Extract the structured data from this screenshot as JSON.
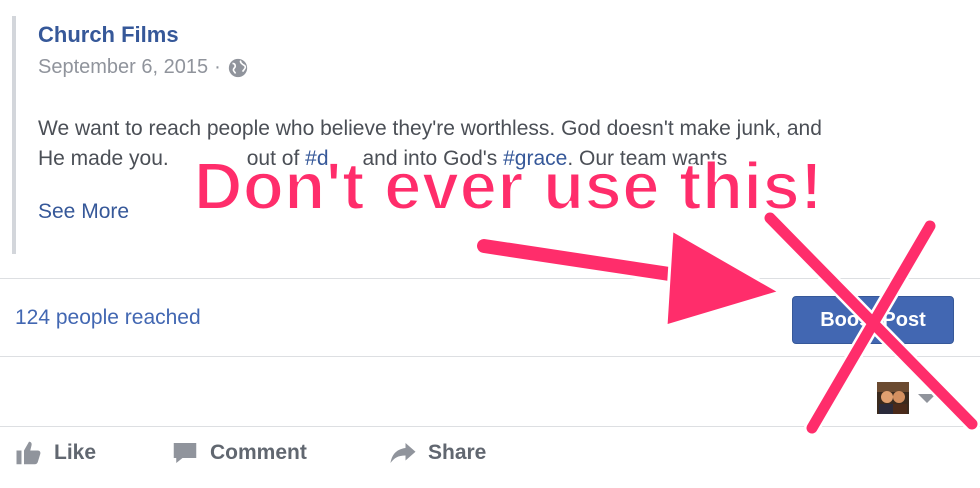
{
  "post": {
    "page_name": "Church Films",
    "date": "September 6, 2015",
    "separator": "·",
    "audience_icon": "globe-icon",
    "text_line1": "We want to reach people who believe they're worthless. God doesn't make junk, and",
    "text_line2_a": "He made you.",
    "text_line2_b": "out of",
    "hashtag1": "#d",
    "text_line2_c": "and into God's",
    "hashtag2": "#grace",
    "text_line2_d": ". Our team wants",
    "see_more": "See More"
  },
  "insights": {
    "reach_text": "124 people reached",
    "boost_label": "Boost Post"
  },
  "actions": {
    "like": "Like",
    "comment": "Comment",
    "share": "Share"
  },
  "annotation": {
    "callout": "Don't ever use this!",
    "accent_color": "#ff2d6b"
  },
  "colors": {
    "link": "#365899",
    "button": "#4267b2",
    "muted": "#90949c"
  }
}
